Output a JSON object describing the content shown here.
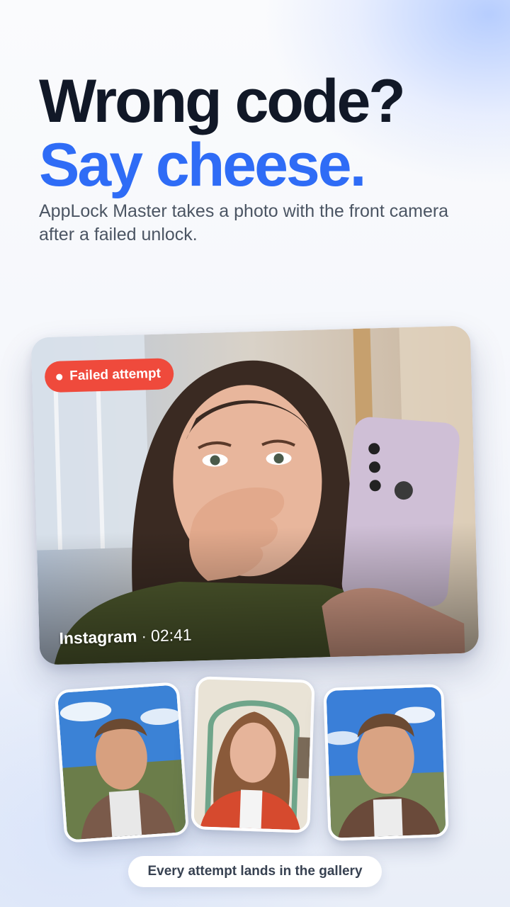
{
  "headline": {
    "line1": "Wrong code?",
    "line2": "Say cheese."
  },
  "subtitle": "AppLock Master takes a photo with the front camera after a failed unlock.",
  "main_card": {
    "badge": "Failed attempt",
    "app_name": "Instagram",
    "separator": "·",
    "time": "02:41"
  },
  "gallery": {
    "caption": "Every attempt lands in the gallery",
    "thumbnails": [
      {
        "subject": "man outdoors, blue sky"
      },
      {
        "subject": "woman in red jacket, arched hallway"
      },
      {
        "subject": "man outdoors, blue sky"
      }
    ]
  },
  "colors": {
    "accent_blue": "#2f6cf6",
    "headline_dark": "#111827",
    "badge_red": "#ef4a3c"
  }
}
